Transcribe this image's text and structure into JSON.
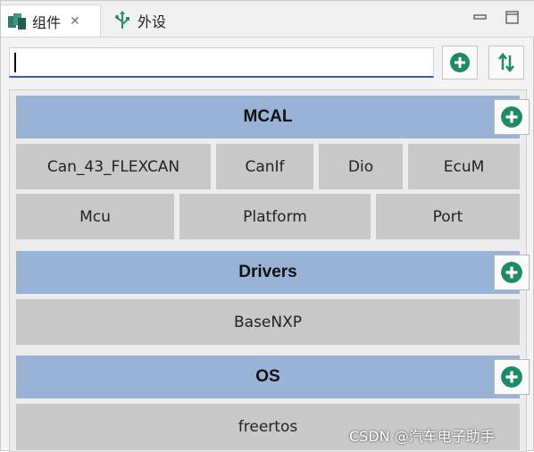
{
  "tabs": [
    {
      "label": "组件",
      "icon": "component-icon",
      "active": true,
      "close_glyph": "✕"
    },
    {
      "label": "外设",
      "icon": "usb-icon",
      "active": false
    }
  ],
  "search": {
    "value": "",
    "placeholder": ""
  },
  "toolbar": {
    "add_icon": "add-icon",
    "sort_icon": "sort-icon"
  },
  "groups": [
    {
      "title": "MCAL",
      "modules": [
        "Can_43_FLEXCAN",
        "CanIf",
        "Dio",
        "EcuM",
        "Mcu",
        "Platform",
        "Port"
      ]
    },
    {
      "title": "Drivers",
      "modules": [
        "BaseNXP"
      ]
    },
    {
      "title": "OS",
      "modules": [
        "freertos"
      ]
    }
  ],
  "watermark": "CSDN @汽车电子助手",
  "colors": {
    "header": "#98b3d5",
    "module": "#c8c8c8",
    "accent_green": "#1e8a68",
    "focus_blue": "#2b63b0"
  }
}
